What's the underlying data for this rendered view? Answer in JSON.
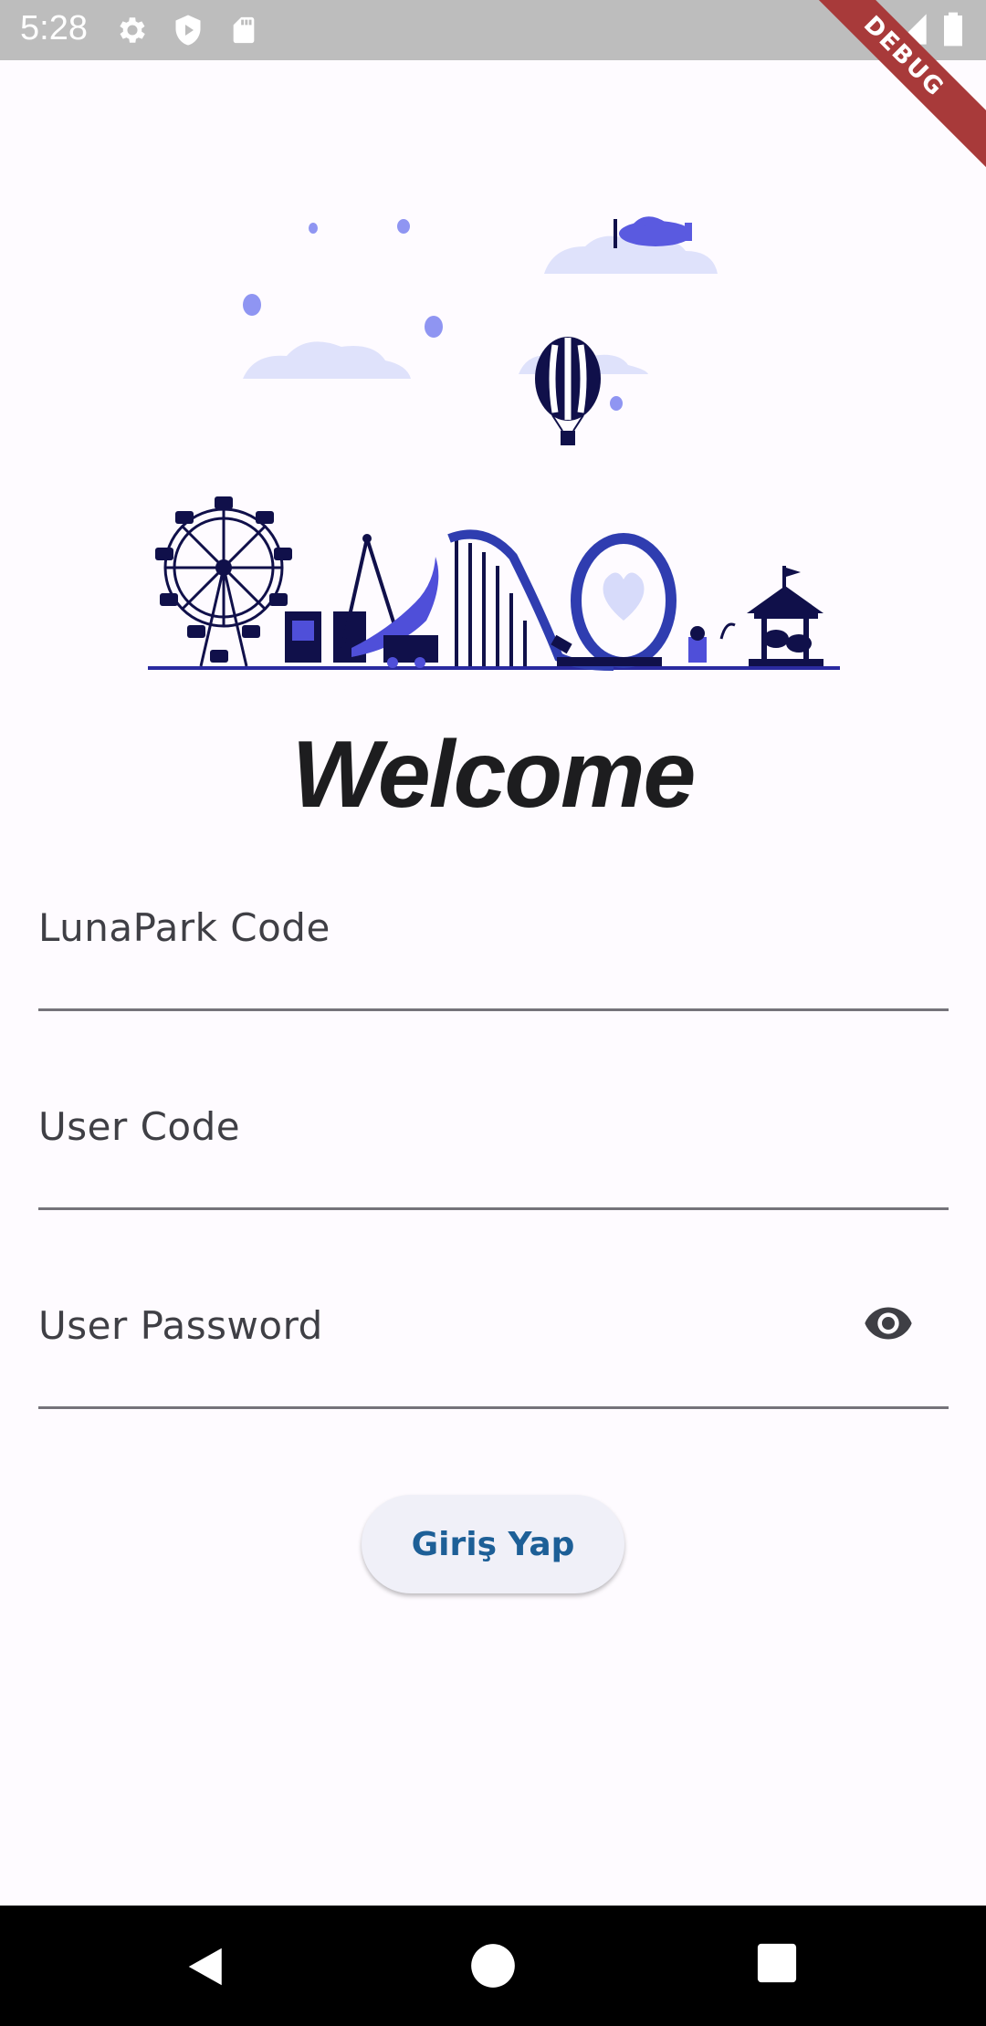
{
  "status_bar": {
    "time": "5:28",
    "icons_left": [
      "gear-icon",
      "shield-play-icon",
      "sd-card-icon"
    ],
    "icons_right": [
      "wifi-icon",
      "signal-icon",
      "battery-icon"
    ],
    "debug_label": "DEBUG"
  },
  "illustration": {
    "description_icon": "amusement-park-illustration",
    "accent_color": "#4f4fd9",
    "dark_color": "#10104a",
    "cloud_color": "#dfe2fb"
  },
  "welcome": {
    "title": "Welcome"
  },
  "form": {
    "lunapark_code": {
      "label": "LunaPark Code",
      "value": ""
    },
    "user_code": {
      "label": "User Code",
      "value": ""
    },
    "user_password": {
      "label": "User Password",
      "value": "",
      "visibility_icon": "eye-icon"
    },
    "submit_label": "Giriş Yap"
  },
  "nav_bar": {
    "buttons": [
      "back-icon",
      "home-icon",
      "recents-icon"
    ]
  },
  "colors": {
    "background": "#fefbff",
    "button_text": "#1d5f97",
    "status_bar": "#bdbdbd"
  }
}
